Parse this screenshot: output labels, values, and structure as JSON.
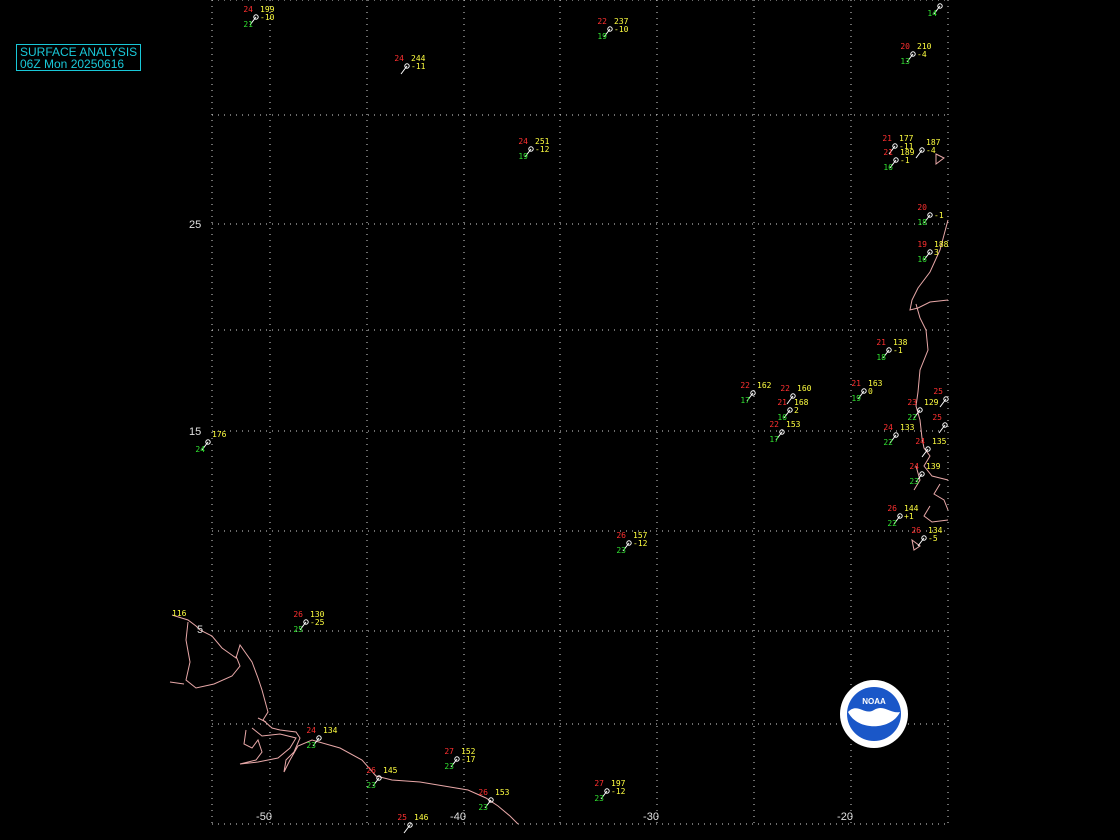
{
  "title": {
    "line1": "SURFACE ANALYSIS",
    "line2": "06Z Mon 20250616"
  },
  "colors": {
    "background": "#000000",
    "title": "#19c8d8",
    "grid": "#d8d8d8",
    "coast": "#e8a8a8",
    "temperature": "#ff3030",
    "dewpoint": "#30e030",
    "pressure": "#ffff40",
    "station": "#ffffff",
    "logo_blue": "#1a57c8"
  },
  "axes": {
    "longitude_labels": [
      "-50",
      "-40",
      "-30",
      "-20"
    ],
    "latitude_labels": [
      "25",
      "15",
      "5"
    ]
  },
  "isobar_label": "116",
  "logo": {
    "name": "noaa-logo",
    "text": "NOAA"
  },
  "stations": [
    {
      "t": "24",
      "td": "21",
      "p": "199",
      "tend": "-10"
    },
    {
      "t": "22",
      "td": "19",
      "p": "237",
      "tend": "-10"
    },
    {
      "t": "24",
      "td": "",
      "p": "244",
      "tend": "-11"
    },
    {
      "t": "20",
      "td": "13",
      "p": "210",
      "tend": "-4"
    },
    {
      "t": "24",
      "td": "19",
      "p": "251",
      "tend": "-12"
    },
    {
      "t": "21",
      "td": "",
      "p": "177",
      "tend": "-11"
    },
    {
      "t": "",
      "td": "",
      "p": "187",
      "tend": "-4"
    },
    {
      "t": "21",
      "td": "16",
      "p": "189",
      "tend": "-1"
    },
    {
      "t": "20",
      "td": "18",
      "p": "",
      "tend": "-1"
    },
    {
      "t": "19",
      "td": "16",
      "p": "188",
      "tend": "3"
    },
    {
      "t": "21",
      "td": "18",
      "p": "138",
      "tend": "-1"
    },
    {
      "t": "22",
      "td": "17",
      "p": "162",
      "tend": ""
    },
    {
      "t": "22",
      "td": "",
      "p": "160",
      "tend": ""
    },
    {
      "t": "21",
      "td": "16",
      "p": "168",
      "tend": "2"
    },
    {
      "t": "22",
      "td": "17",
      "p": "153",
      "tend": ""
    },
    {
      "t": "21",
      "td": "19",
      "p": "163",
      "tend": "0"
    },
    {
      "t": "25",
      "td": "",
      "p": "",
      "tend": ""
    },
    {
      "t": "23",
      "td": "22",
      "p": "129",
      "tend": ""
    },
    {
      "t": "25",
      "td": "",
      "p": "",
      "tend": ""
    },
    {
      "t": "24",
      "td": "22",
      "p": "133",
      "tend": ""
    },
    {
      "t": "24",
      "td": "",
      "p": "135",
      "tend": ""
    },
    {
      "t": "24",
      "td": "23",
      "p": "139",
      "tend": ""
    },
    {
      "t": "",
      "td": "24",
      "p": "176",
      "tend": ""
    },
    {
      "t": "26",
      "td": "22",
      "p": "144",
      "tend": "+1"
    },
    {
      "t": "26",
      "td": "23",
      "p": "157",
      "tend": "-12"
    },
    {
      "t": "26",
      "td": "",
      "p": "134",
      "tend": "-5"
    },
    {
      "t": "26",
      "td": "25",
      "p": "130",
      "tend": "-25"
    },
    {
      "t": "24",
      "td": "23",
      "p": "134",
      "tend": ""
    },
    {
      "t": "27",
      "td": "23",
      "p": "152",
      "tend": "-17"
    },
    {
      "t": "26",
      "td": "23",
      "p": "145",
      "tend": ""
    },
    {
      "t": "26",
      "td": "23",
      "p": "153",
      "tend": ""
    },
    {
      "t": "27",
      "td": "23",
      "p": "197",
      "tend": "-12"
    },
    {
      "t": "25",
      "td": "",
      "p": "146",
      "tend": ""
    },
    {
      "t": "",
      "td": "14",
      "p": "",
      "tend": ""
    }
  ]
}
